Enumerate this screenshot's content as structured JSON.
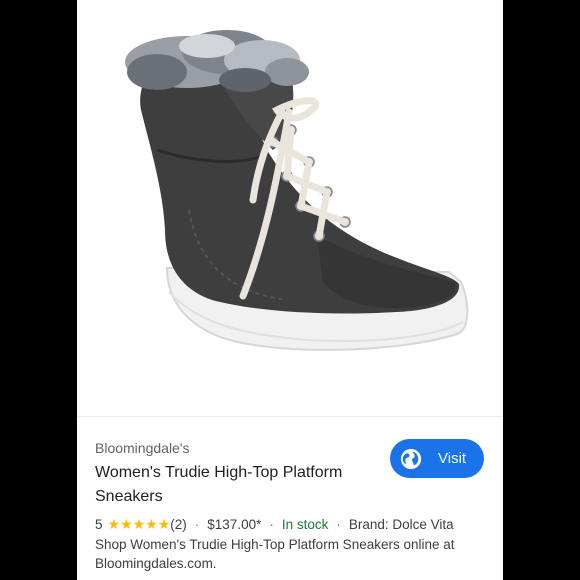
{
  "result": {
    "source": "Bloomingdale's",
    "title": "Women's Trudie High-Top Platform Sneakers",
    "visit_label": "Visit",
    "rating_value": "5",
    "rating_stars": "★★★★★",
    "review_count": "(2)",
    "price": "$137.00*",
    "availability": "In stock",
    "brand": "Brand: Dolce Vita",
    "description": "Shop Women's Trudie High-Top Platform Sneakers online at Bloomingdales.com.",
    "separator": "·"
  },
  "icons": {
    "visit_icon": "globe-icon",
    "rating_icon": "star-icon"
  },
  "colors": {
    "accent": "#1a73e8",
    "in_stock": "#188038",
    "star": "#fbbc04",
    "shoe_suede": "#3d3d3d",
    "sole": "#f2f2f2"
  }
}
